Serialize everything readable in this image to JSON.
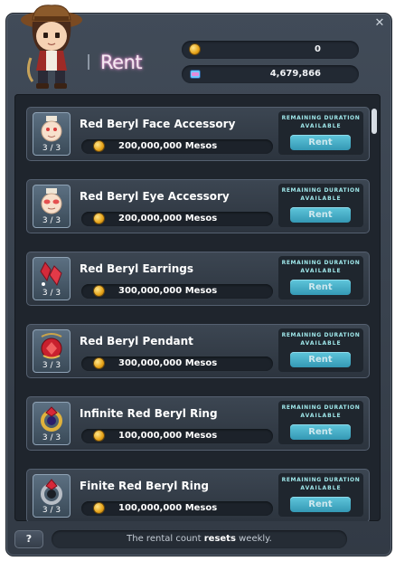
{
  "window": {
    "title": "Rent",
    "close_glyph": "✕"
  },
  "currencies": [
    {
      "icon": "meso-coin-icon",
      "value": "0"
    },
    {
      "icon": "maple-point-icon",
      "value": "4,679,866"
    }
  ],
  "items": [
    {
      "name": "Red Beryl Face Accessory",
      "price": "200,000,000 Mesos",
      "count": "3 / 3",
      "remaining_label": "REMAINING DURATION",
      "status": "AVAILABLE",
      "button": "Rent",
      "icon": "face-accessory-icon"
    },
    {
      "name": "Red Beryl Eye Accessory",
      "price": "200,000,000 Mesos",
      "count": "3 / 3",
      "remaining_label": "REMAINING DURATION",
      "status": "AVAILABLE",
      "button": "Rent",
      "icon": "eye-accessory-icon"
    },
    {
      "name": "Red Beryl Earrings",
      "price": "300,000,000 Mesos",
      "count": "3 / 3",
      "remaining_label": "REMAINING DURATION",
      "status": "AVAILABLE",
      "button": "Rent",
      "icon": "earrings-icon"
    },
    {
      "name": "Red Beryl Pendant",
      "price": "300,000,000 Mesos",
      "count": "3 / 3",
      "remaining_label": "REMAINING DURATION",
      "status": "AVAILABLE",
      "button": "Rent",
      "icon": "pendant-icon"
    },
    {
      "name": "Infinite Red Beryl Ring",
      "price": "100,000,000 Mesos",
      "count": "3 / 3",
      "remaining_label": "REMAINING DURATION",
      "status": "AVAILABLE",
      "button": "Rent",
      "icon": "infinite-ring-icon"
    },
    {
      "name": "Finite Red Beryl Ring",
      "price": "100,000,000 Mesos",
      "count": "3 / 3",
      "remaining_label": "REMAINING DURATION",
      "status": "AVAILABLE",
      "button": "Rent",
      "icon": "finite-ring-icon"
    }
  ],
  "footer": {
    "help": "?",
    "text_before": "The rental count",
    "text_bold": "resets",
    "text_after": "weekly."
  }
}
